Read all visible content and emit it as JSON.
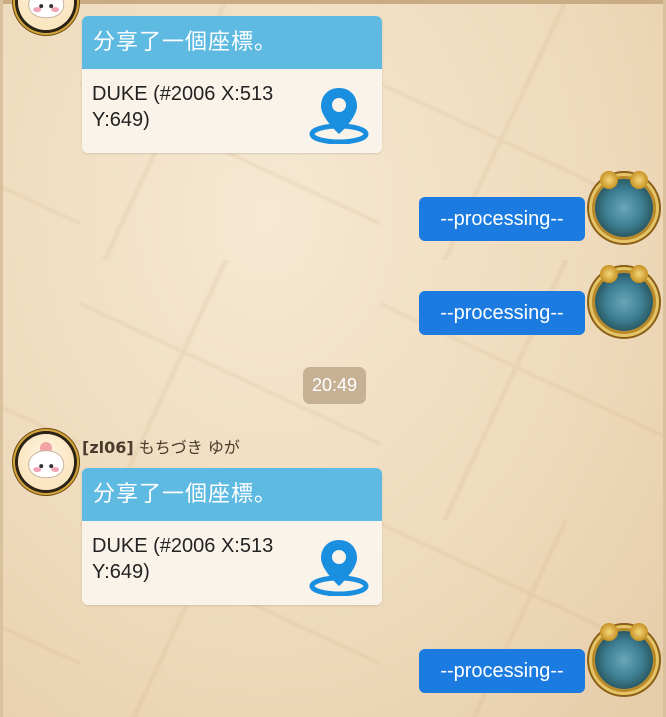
{
  "chat": {
    "messages": [
      {
        "type": "location",
        "sender": "other",
        "header": "分享了一個座標。",
        "location_text": "DUKE (#2006 X:513 Y:649)"
      },
      {
        "type": "text",
        "sender": "self",
        "text": "--processing--"
      },
      {
        "type": "text",
        "sender": "self",
        "text": "--processing--"
      },
      {
        "type": "timestamp",
        "text": "20:49"
      },
      {
        "type": "location",
        "sender": "other",
        "sender_tag": "[zl06]",
        "sender_name": "もちづき ゆが",
        "header": "分享了一個座標。",
        "location_text": "DUKE (#2006 X:513 Y:649)"
      },
      {
        "type": "text",
        "sender": "self",
        "text": "--processing--"
      }
    ]
  },
  "colors": {
    "header_blue": "#5fbae2",
    "bubble_blue": "#1b7be0",
    "pin_blue": "#1a8fe0",
    "background": "#efdbbd"
  },
  "icons": {
    "location": "map-pin-icon"
  }
}
